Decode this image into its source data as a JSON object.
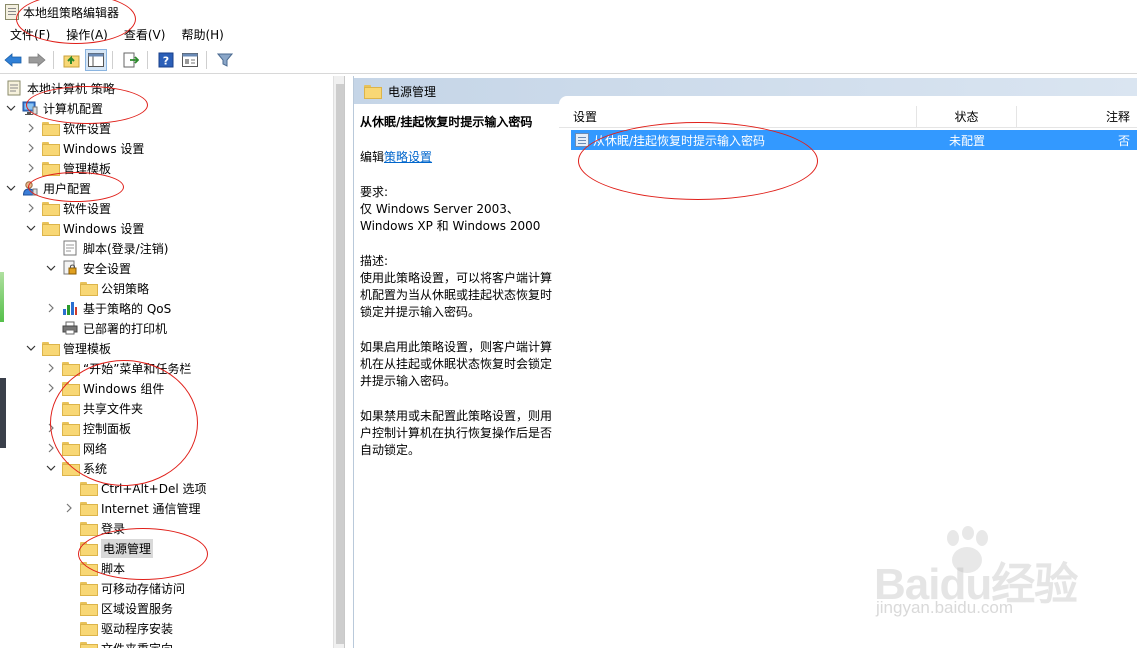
{
  "window": {
    "title": "本地组策略编辑器"
  },
  "menu": [
    "文件(F)",
    "操作(A)",
    "查看(V)",
    "帮助(H)"
  ],
  "toolbar": [
    "back-icon",
    "forward-icon",
    "up-folder-icon",
    "show-hide-tree-icon",
    "export-list-icon",
    "help-icon",
    "properties-icon",
    "filter-icon"
  ],
  "tree": {
    "root": "本地计算机 策略",
    "computer_config": "计算机配置",
    "cc_software": "软件设置",
    "cc_windows": "Windows 设置",
    "cc_admin": "管理模板",
    "user_config": "用户配置",
    "uc_software": "软件设置",
    "uc_windows": "Windows 设置",
    "scripts_logon": "脚本(登录/注销)",
    "security": "安全设置",
    "pubkey": "公钥策略",
    "qos": "基于策略的 QoS",
    "printers": "已部署的打印机",
    "uc_admin": "管理模板",
    "start_menu": "“开始”菜单和任务栏",
    "win_components": "Windows 组件",
    "shared_folders": "共享文件夹",
    "control_panel": "控制面板",
    "network": "网络",
    "system": "系统",
    "ctrl_alt_del": "Ctrl+Alt+Del 选项",
    "internet_comm": "Internet 通信管理",
    "logon": "登录",
    "power": "电源管理",
    "scripts": "脚本",
    "removable": "可移动存储访问",
    "locale": "区域设置服务",
    "driver_install": "驱动程序安装",
    "folder_redirect": "文件夹重定向"
  },
  "panel": {
    "header": "电源管理"
  },
  "description": {
    "title": "从休眠/挂起恢复时提示输入密码",
    "edit_prefix": "编辑",
    "edit_link": "策略设置",
    "req_label": "要求:",
    "req_text": "仅 Windows Server 2003、Windows XP 和 Windows 2000",
    "desc_label": "描述:",
    "p1": "使用此策略设置，可以将客户端计算机配置为当从休眠或挂起状态恢复时锁定并提示输入密码。",
    "p2": "如果启用此策略设置，则客户端计算机在从挂起或休眠状态恢复时会锁定并提示输入密码。",
    "p3": "如果禁用或未配置此策略设置，则用户控制计算机在执行恢复操作后是否自动锁定。"
  },
  "list": {
    "columns": {
      "setting": "设置",
      "state": "状态",
      "note": "注释"
    },
    "rows": [
      {
        "setting": "从休眠/挂起恢复时提示输入密码",
        "state": "未配置",
        "note": "否"
      }
    ]
  },
  "watermark": {
    "main": "Baidu经验",
    "sub": "jingyan.baidu.com"
  },
  "colors": {
    "selection": "#3399ff",
    "annotation": "#e0201a",
    "header_gradient": "#c5d5e7"
  }
}
